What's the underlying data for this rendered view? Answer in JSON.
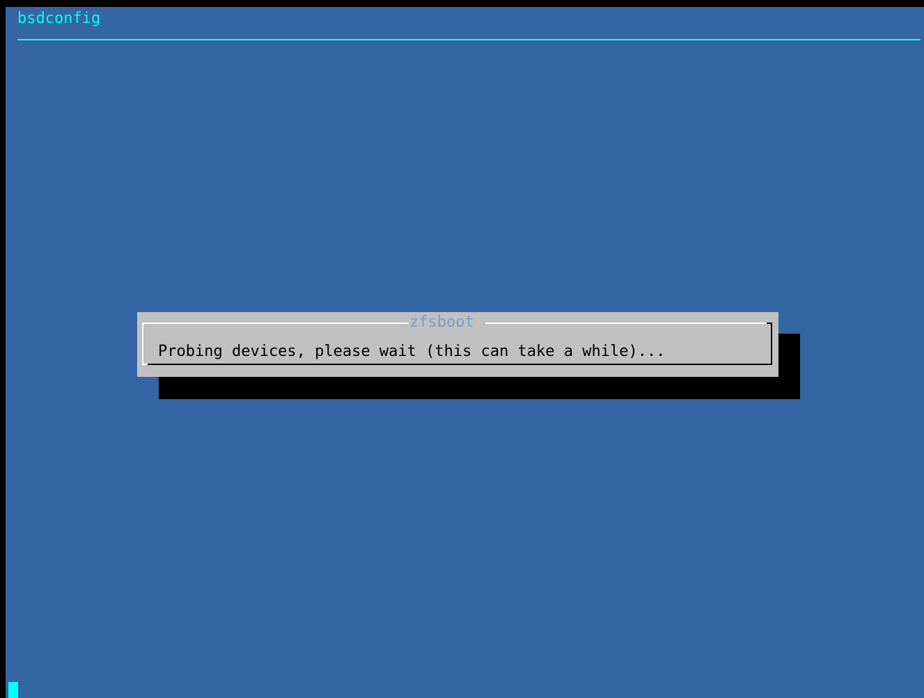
{
  "backtitle": "bsdconfig",
  "dialog": {
    "title": "zfsboot",
    "message": "Probing devices, please wait (this can take a while)..."
  },
  "colors": {
    "background": "#3465a4",
    "backtitle": "#00ffff",
    "dialog_face": "#c0c0c0",
    "dialog_title": "#729fcf",
    "shadow": "#000000"
  },
  "icons": {
    "cursor": "text-cursor-block"
  }
}
